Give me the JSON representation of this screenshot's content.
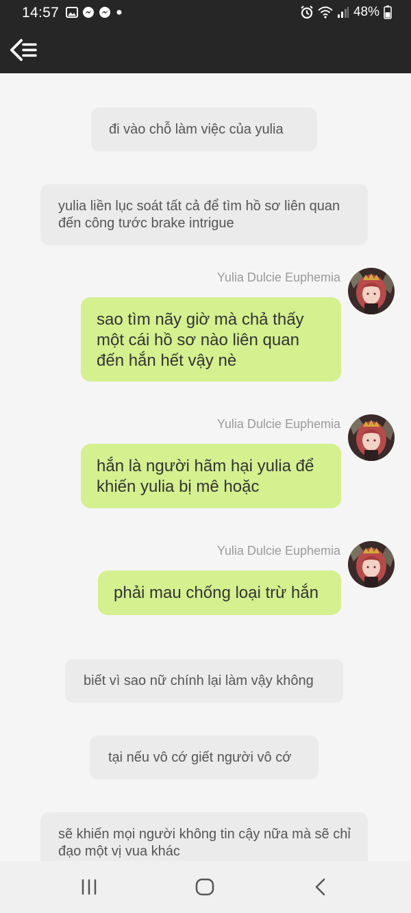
{
  "status_bar": {
    "time": "14:57",
    "battery": "48%",
    "left_icons": [
      "image-icon",
      "messenger-icon",
      "messenger-icon",
      "dot-icon"
    ],
    "right_icons": [
      "alarm-icon",
      "wifi-icon",
      "signal-icon",
      "battery-icon"
    ]
  },
  "toolbar": {
    "back_icon": "back-list-icon"
  },
  "messages": [
    {
      "type": "system",
      "text": "đi vào chỗ làm việc của yulia"
    },
    {
      "type": "system",
      "text": "yulia liền lục soát tất cả để tìm hồ sơ liên quan đến công tước brake intrigue"
    },
    {
      "type": "user",
      "sender": "Yulia Dulcie Euphemia",
      "text": "sao tìm nãy giờ mà chả thấy một cái hồ sơ nào liên quan đến hắn hết vậy nè"
    },
    {
      "type": "user",
      "sender": "Yulia Dulcie Euphemia",
      "text": "hắn là người hãm hại yulia để khiến yulia bị mê hoặc"
    },
    {
      "type": "user",
      "sender": "Yulia Dulcie Euphemia",
      "text": "phải mau chống loại trừ hắn"
    },
    {
      "type": "system",
      "text": "biết vì sao nữ chính lại làm vậy không"
    },
    {
      "type": "system",
      "text": "tại nếu vô cớ giết người vô cớ"
    },
    {
      "type": "system",
      "text": "sẽ khiến mọi người không tin cậy nữa mà sẽ chỉ đạo một vị vua khác"
    }
  ],
  "nav_bar": {
    "icons": [
      "recent-apps-icon",
      "home-icon",
      "back-icon"
    ]
  },
  "colors": {
    "user_bubble": "#d4f08f",
    "system_bubble": "#ebebeb",
    "bars": "#262626"
  }
}
